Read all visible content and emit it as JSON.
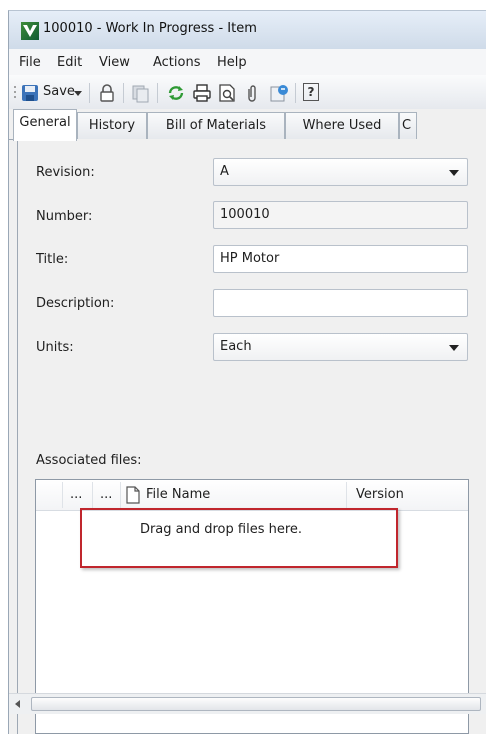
{
  "window": {
    "title": "100010 - Work In Progress - Item"
  },
  "menu": {
    "items": [
      "File",
      "Edit",
      "View",
      "Actions",
      "Help"
    ]
  },
  "toolbar": {
    "save_label": "Save",
    "icons": [
      "save-icon",
      "dropdown-arrow-icon",
      "lock-icon",
      "copy-icon",
      "refresh-icon",
      "print-icon",
      "print-preview-icon",
      "attach-icon",
      "properties-icon",
      "help-icon"
    ]
  },
  "tabs": [
    "General",
    "History",
    "Bill of Materials",
    "Where Used",
    "C"
  ],
  "form": {
    "revision_label": "Revision:",
    "revision_value": "A",
    "number_label": "Number:",
    "number_value": "100010",
    "title_label": "Title:",
    "title_value": "HP Motor",
    "description_label": "Description:",
    "description_value": "",
    "units_label": "Units:",
    "units_value": "Each"
  },
  "files": {
    "label": "Associated files:",
    "columns": [
      "...",
      "...",
      "File Name",
      "Version"
    ],
    "empty_text": "Drag and drop files here."
  },
  "colors": {
    "highlight_border": "#c0262d",
    "window_bg": "#f0f0f0"
  }
}
